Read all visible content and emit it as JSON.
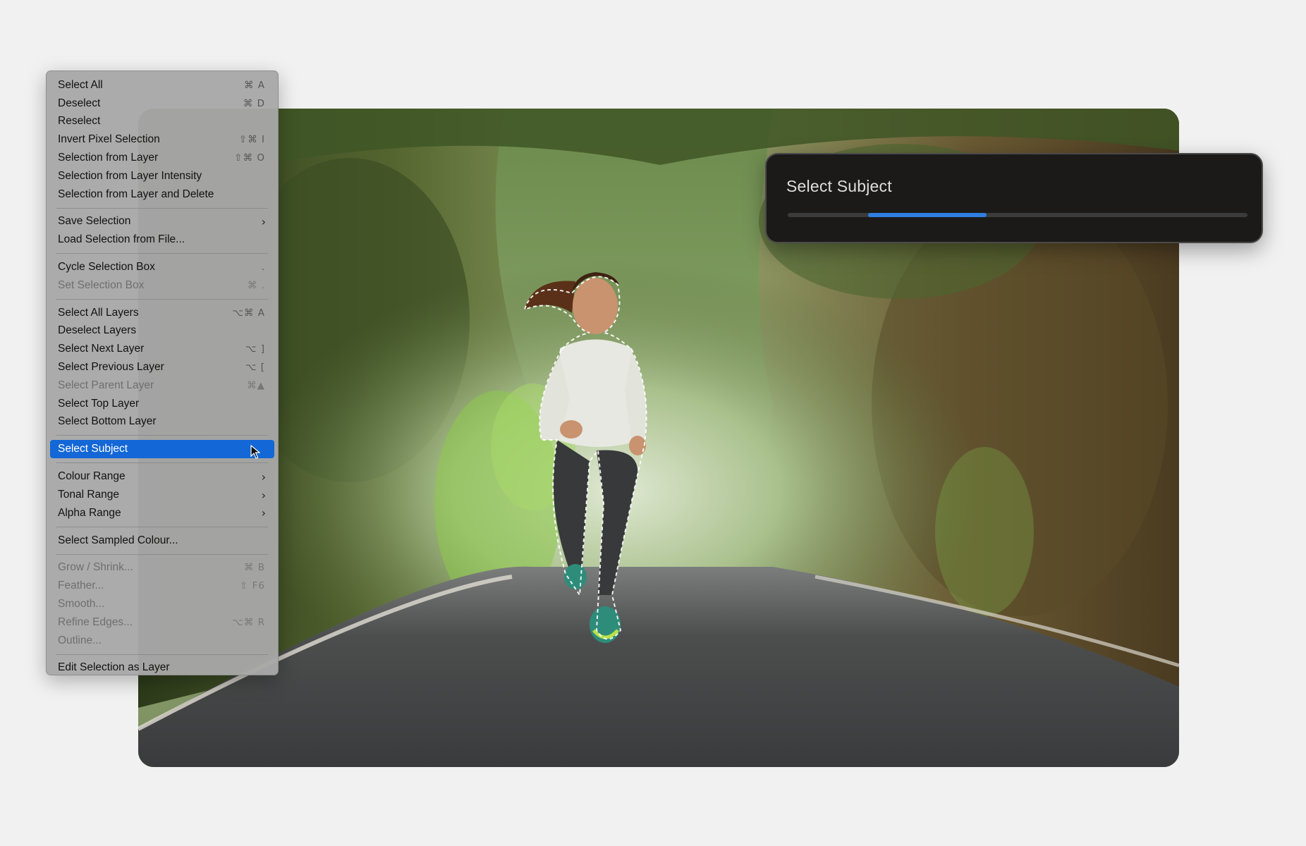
{
  "menu": {
    "items": [
      {
        "label": "Select All",
        "shortcut": "⌘ A",
        "state": "enabled"
      },
      {
        "label": "Deselect",
        "shortcut": "⌘ D",
        "state": "enabled"
      },
      {
        "label": "Reselect",
        "shortcut": "",
        "state": "enabled"
      },
      {
        "label": "Invert Pixel Selection",
        "shortcut": "⇧⌘ I",
        "state": "enabled"
      },
      {
        "label": "Selection from Layer",
        "shortcut": "⇧⌘ O",
        "state": "enabled"
      },
      {
        "label": "Selection from Layer Intensity",
        "shortcut": "",
        "state": "enabled"
      },
      {
        "label": "Selection from Layer and Delete",
        "shortcut": "",
        "state": "enabled"
      },
      {
        "separator": true
      },
      {
        "label": "Save Selection",
        "submenu": true,
        "state": "enabled"
      },
      {
        "label": "Load Selection from File...",
        "shortcut": "",
        "state": "enabled"
      },
      {
        "separator": true
      },
      {
        "label": "Cycle Selection Box",
        "shortcut": ".",
        "state": "enabled"
      },
      {
        "label": "Set Selection Box",
        "shortcut": "⌘ .",
        "state": "disabled"
      },
      {
        "separator": true
      },
      {
        "label": "Select All Layers",
        "shortcut": "⌥⌘ A",
        "state": "enabled"
      },
      {
        "label": "Deselect Layers",
        "shortcut": "",
        "state": "enabled"
      },
      {
        "label": "Select Next Layer",
        "shortcut": "⌥ ]",
        "state": "enabled"
      },
      {
        "label": "Select Previous Layer",
        "shortcut": "⌥ [",
        "state": "enabled"
      },
      {
        "label": "Select Parent Layer",
        "shortcut": "⌘▲",
        "state": "disabled"
      },
      {
        "label": "Select Top Layer",
        "shortcut": "",
        "state": "enabled"
      },
      {
        "label": "Select Bottom Layer",
        "shortcut": "",
        "state": "enabled"
      },
      {
        "separator": true
      },
      {
        "label": "Select Subject",
        "shortcut": "",
        "state": "active"
      },
      {
        "separator": true
      },
      {
        "label": "Colour Range",
        "submenu": true,
        "state": "enabled"
      },
      {
        "label": "Tonal Range",
        "submenu": true,
        "state": "enabled"
      },
      {
        "label": "Alpha Range",
        "submenu": true,
        "state": "enabled"
      },
      {
        "separator": true
      },
      {
        "label": "Select Sampled Colour...",
        "shortcut": "",
        "state": "enabled"
      },
      {
        "separator": true
      },
      {
        "label": "Grow / Shrink...",
        "shortcut": "⌘ B",
        "state": "disabled"
      },
      {
        "label": "Feather...",
        "shortcut": "⇧ F6",
        "state": "disabled"
      },
      {
        "label": "Smooth...",
        "shortcut": "",
        "state": "disabled"
      },
      {
        "label": "Refine Edges...",
        "shortcut": "⌥⌘ R",
        "state": "disabled"
      },
      {
        "label": "Outline...",
        "shortcut": "",
        "state": "disabled"
      },
      {
        "separator": true
      },
      {
        "label": "Edit Selection as Layer",
        "shortcut": "",
        "state": "enabled"
      }
    ]
  },
  "dialog": {
    "title": "Select Subject",
    "progress_start": 0.175,
    "progress_end": 0.433
  },
  "colors": {
    "highlight": "#1367d6",
    "progress": "#2f7ee0",
    "dialog_bg": "#1b1a19"
  },
  "icons": {
    "submenu_arrow": "chevron-right-icon",
    "pointer": "cursor-arrow-icon"
  }
}
